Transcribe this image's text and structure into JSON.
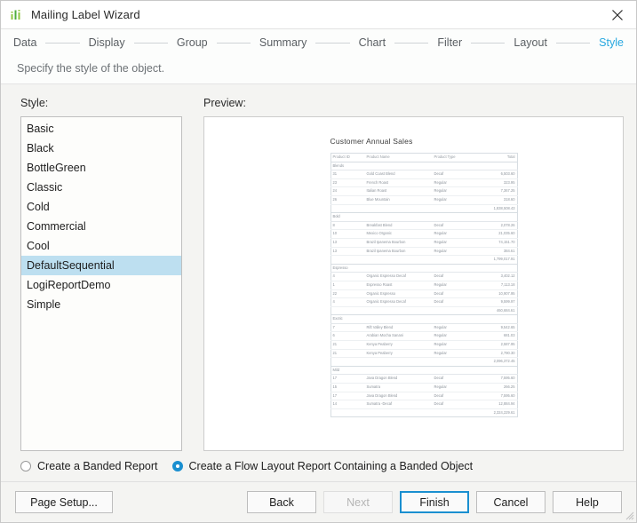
{
  "window": {
    "title": "Mailing Label Wizard",
    "app_icon": "bar-chart-icon",
    "close_icon": "close-icon",
    "accent_color": "#27a8e0",
    "selection_color": "#bddff0"
  },
  "stepnav": {
    "steps": [
      {
        "label": "Data",
        "active": false
      },
      {
        "label": "Display",
        "active": false
      },
      {
        "label": "Group",
        "active": false
      },
      {
        "label": "Summary",
        "active": false
      },
      {
        "label": "Chart",
        "active": false
      },
      {
        "label": "Filter",
        "active": false
      },
      {
        "label": "Layout",
        "active": false
      },
      {
        "label": "Style",
        "active": true
      }
    ]
  },
  "subtitle": "Specify the style of the object.",
  "style_panel": {
    "label": "Style:",
    "items": [
      "Basic",
      "Black",
      "BottleGreen",
      "Classic",
      "Cold",
      "Commercial",
      "Cool",
      "DefaultSequential",
      "LogiReportDemo",
      "Simple"
    ],
    "selected": "DefaultSequential"
  },
  "preview": {
    "label": "Preview:",
    "report": {
      "title": "Customer Annual Sales",
      "columns": [
        "Product ID",
        "Product Name",
        "Product Type",
        "Total"
      ],
      "groups": [
        {
          "name": "Blends",
          "rows": [
            {
              "id": "31",
              "name": "Gold Coast Blend",
              "type": "Decaf",
              "total": "6,503.60"
            },
            {
              "id": "23",
              "name": "French Roast",
              "type": "Regular",
              "total": "323.95"
            },
            {
              "id": "24",
              "name": "Italian Roast",
              "type": "Regular",
              "total": "7,367.25"
            },
            {
              "id": "26",
              "name": "Blue Mountain",
              "type": "Regular",
              "total": "318.60"
            }
          ],
          "subtotal": "1,838,508.43"
        },
        {
          "name": "Bold",
          "rows": [
            {
              "id": "8",
              "name": "Breakfast Blend",
              "type": "Decaf",
              "total": "2,078.26"
            },
            {
              "id": "10",
              "name": "Mexico Organic",
              "type": "Regular",
              "total": "21,035.60"
            },
            {
              "id": "13",
              "name": "Brazil Ipanema Bourbon",
              "type": "Regular",
              "total": "74,151.70"
            },
            {
              "id": "13",
              "name": "Brazil Ipanema Bourbon",
              "type": "Regular",
              "total": "384.61"
            }
          ],
          "subtotal": "1,799,017.91"
        },
        {
          "name": "Espresso",
          "rows": [
            {
              "id": "4",
              "name": "Organic Espresso Decaf",
              "type": "Decaf",
              "total": "3,402.12"
            },
            {
              "id": "1",
              "name": "Espresso Roast",
              "type": "Regular",
              "total": "7,113.18"
            },
            {
              "id": "22",
              "name": "Organic Espresso",
              "type": "Decaf",
              "total": "10,907.95"
            },
            {
              "id": "4",
              "name": "Organic Espresso Decaf",
              "type": "Decaf",
              "total": "9,599.97"
            }
          ],
          "subtotal": "460,684.61"
        },
        {
          "name": "Exotic",
          "rows": [
            {
              "id": "7",
              "name": "Rift Valley Blend",
              "type": "Regular",
              "total": "9,542.65"
            },
            {
              "id": "6",
              "name": "Arabian Mocha Sanani",
              "type": "Regular",
              "total": "681.03"
            },
            {
              "id": "21",
              "name": "Kenya Peaberry",
              "type": "Regular",
              "total": "2,587.95"
            },
            {
              "id": "21",
              "name": "Kenya Peaberry",
              "type": "Regular",
              "total": "2,790.30"
            }
          ],
          "subtotal": "2,096,372.45"
        },
        {
          "name": "Mild",
          "rows": [
            {
              "id": "17",
              "name": "Java Dragon Blend",
              "type": "Decaf",
              "total": "7,595.60"
            },
            {
              "id": "15",
              "name": "Sumatra",
              "type": "Regular",
              "total": "266.25"
            },
            {
              "id": "17",
              "name": "Java Dragon Blend",
              "type": "Decaf",
              "total": "7,595.60"
            },
            {
              "id": "14",
              "name": "Sumatra -Decaf",
              "type": "Decaf",
              "total": "12,884.94"
            }
          ],
          "subtotal": "2,324,229.61"
        }
      ]
    }
  },
  "report_type": {
    "options": [
      {
        "label": "Create a Banded Report",
        "selected": false
      },
      {
        "label": "Create a Flow Layout Report Containing a Banded Object",
        "selected": true
      }
    ]
  },
  "buttons": {
    "page_setup": "Page Setup...",
    "back": "Back",
    "next": "Next",
    "finish": "Finish",
    "cancel": "Cancel",
    "help": "Help"
  }
}
